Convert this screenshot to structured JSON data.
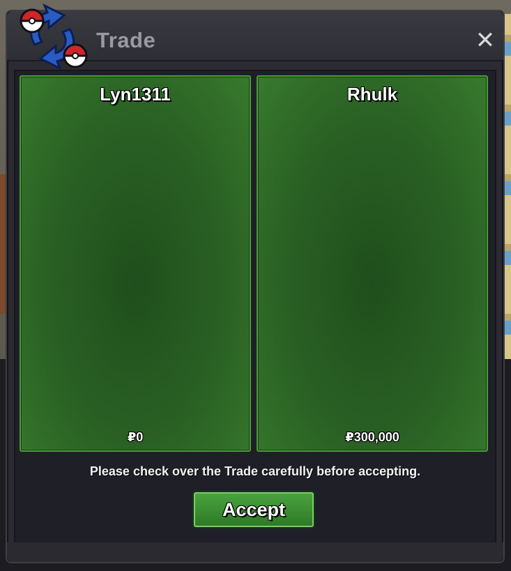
{
  "window": {
    "title": "Trade",
    "close_glyph": "✕"
  },
  "icons": {
    "trade": "trade-arrows-pokeball-icon",
    "close": "close-icon"
  },
  "panels": [
    {
      "player": "Lyn1311",
      "money": "₽0"
    },
    {
      "player": "Rhulk",
      "money": "₽300,000"
    }
  ],
  "notice": "Please check over the Trade carefully before accepting.",
  "accept_label": "Accept",
  "colors": {
    "panel_green": "#2a6024",
    "panel_border": "#4a9a3a",
    "button_green": "#3a8f31",
    "window_bg": "#2b2b31"
  }
}
